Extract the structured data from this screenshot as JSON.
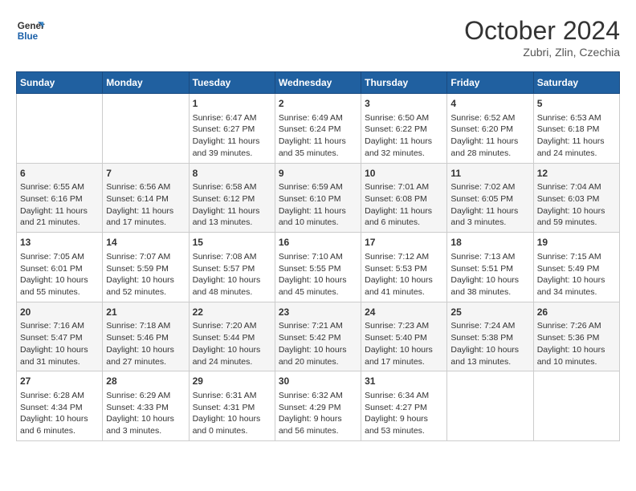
{
  "header": {
    "logo_line1": "General",
    "logo_line2": "Blue",
    "month": "October 2024",
    "location": "Zubri, Zlin, Czechia"
  },
  "weekdays": [
    "Sunday",
    "Monday",
    "Tuesday",
    "Wednesday",
    "Thursday",
    "Friday",
    "Saturday"
  ],
  "weeks": [
    [
      {
        "day": "",
        "info": ""
      },
      {
        "day": "",
        "info": ""
      },
      {
        "day": "1",
        "info": "Sunrise: 6:47 AM\nSunset: 6:27 PM\nDaylight: 11 hours and 39 minutes."
      },
      {
        "day": "2",
        "info": "Sunrise: 6:49 AM\nSunset: 6:24 PM\nDaylight: 11 hours and 35 minutes."
      },
      {
        "day": "3",
        "info": "Sunrise: 6:50 AM\nSunset: 6:22 PM\nDaylight: 11 hours and 32 minutes."
      },
      {
        "day": "4",
        "info": "Sunrise: 6:52 AM\nSunset: 6:20 PM\nDaylight: 11 hours and 28 minutes."
      },
      {
        "day": "5",
        "info": "Sunrise: 6:53 AM\nSunset: 6:18 PM\nDaylight: 11 hours and 24 minutes."
      }
    ],
    [
      {
        "day": "6",
        "info": "Sunrise: 6:55 AM\nSunset: 6:16 PM\nDaylight: 11 hours and 21 minutes."
      },
      {
        "day": "7",
        "info": "Sunrise: 6:56 AM\nSunset: 6:14 PM\nDaylight: 11 hours and 17 minutes."
      },
      {
        "day": "8",
        "info": "Sunrise: 6:58 AM\nSunset: 6:12 PM\nDaylight: 11 hours and 13 minutes."
      },
      {
        "day": "9",
        "info": "Sunrise: 6:59 AM\nSunset: 6:10 PM\nDaylight: 11 hours and 10 minutes."
      },
      {
        "day": "10",
        "info": "Sunrise: 7:01 AM\nSunset: 6:08 PM\nDaylight: 11 hours and 6 minutes."
      },
      {
        "day": "11",
        "info": "Sunrise: 7:02 AM\nSunset: 6:05 PM\nDaylight: 11 hours and 3 minutes."
      },
      {
        "day": "12",
        "info": "Sunrise: 7:04 AM\nSunset: 6:03 PM\nDaylight: 10 hours and 59 minutes."
      }
    ],
    [
      {
        "day": "13",
        "info": "Sunrise: 7:05 AM\nSunset: 6:01 PM\nDaylight: 10 hours and 55 minutes."
      },
      {
        "day": "14",
        "info": "Sunrise: 7:07 AM\nSunset: 5:59 PM\nDaylight: 10 hours and 52 minutes."
      },
      {
        "day": "15",
        "info": "Sunrise: 7:08 AM\nSunset: 5:57 PM\nDaylight: 10 hours and 48 minutes."
      },
      {
        "day": "16",
        "info": "Sunrise: 7:10 AM\nSunset: 5:55 PM\nDaylight: 10 hours and 45 minutes."
      },
      {
        "day": "17",
        "info": "Sunrise: 7:12 AM\nSunset: 5:53 PM\nDaylight: 10 hours and 41 minutes."
      },
      {
        "day": "18",
        "info": "Sunrise: 7:13 AM\nSunset: 5:51 PM\nDaylight: 10 hours and 38 minutes."
      },
      {
        "day": "19",
        "info": "Sunrise: 7:15 AM\nSunset: 5:49 PM\nDaylight: 10 hours and 34 minutes."
      }
    ],
    [
      {
        "day": "20",
        "info": "Sunrise: 7:16 AM\nSunset: 5:47 PM\nDaylight: 10 hours and 31 minutes."
      },
      {
        "day": "21",
        "info": "Sunrise: 7:18 AM\nSunset: 5:46 PM\nDaylight: 10 hours and 27 minutes."
      },
      {
        "day": "22",
        "info": "Sunrise: 7:20 AM\nSunset: 5:44 PM\nDaylight: 10 hours and 24 minutes."
      },
      {
        "day": "23",
        "info": "Sunrise: 7:21 AM\nSunset: 5:42 PM\nDaylight: 10 hours and 20 minutes."
      },
      {
        "day": "24",
        "info": "Sunrise: 7:23 AM\nSunset: 5:40 PM\nDaylight: 10 hours and 17 minutes."
      },
      {
        "day": "25",
        "info": "Sunrise: 7:24 AM\nSunset: 5:38 PM\nDaylight: 10 hours and 13 minutes."
      },
      {
        "day": "26",
        "info": "Sunrise: 7:26 AM\nSunset: 5:36 PM\nDaylight: 10 hours and 10 minutes."
      }
    ],
    [
      {
        "day": "27",
        "info": "Sunrise: 6:28 AM\nSunset: 4:34 PM\nDaylight: 10 hours and 6 minutes."
      },
      {
        "day": "28",
        "info": "Sunrise: 6:29 AM\nSunset: 4:33 PM\nDaylight: 10 hours and 3 minutes."
      },
      {
        "day": "29",
        "info": "Sunrise: 6:31 AM\nSunset: 4:31 PM\nDaylight: 10 hours and 0 minutes."
      },
      {
        "day": "30",
        "info": "Sunrise: 6:32 AM\nSunset: 4:29 PM\nDaylight: 9 hours and 56 minutes."
      },
      {
        "day": "31",
        "info": "Sunrise: 6:34 AM\nSunset: 4:27 PM\nDaylight: 9 hours and 53 minutes."
      },
      {
        "day": "",
        "info": ""
      },
      {
        "day": "",
        "info": ""
      }
    ]
  ]
}
